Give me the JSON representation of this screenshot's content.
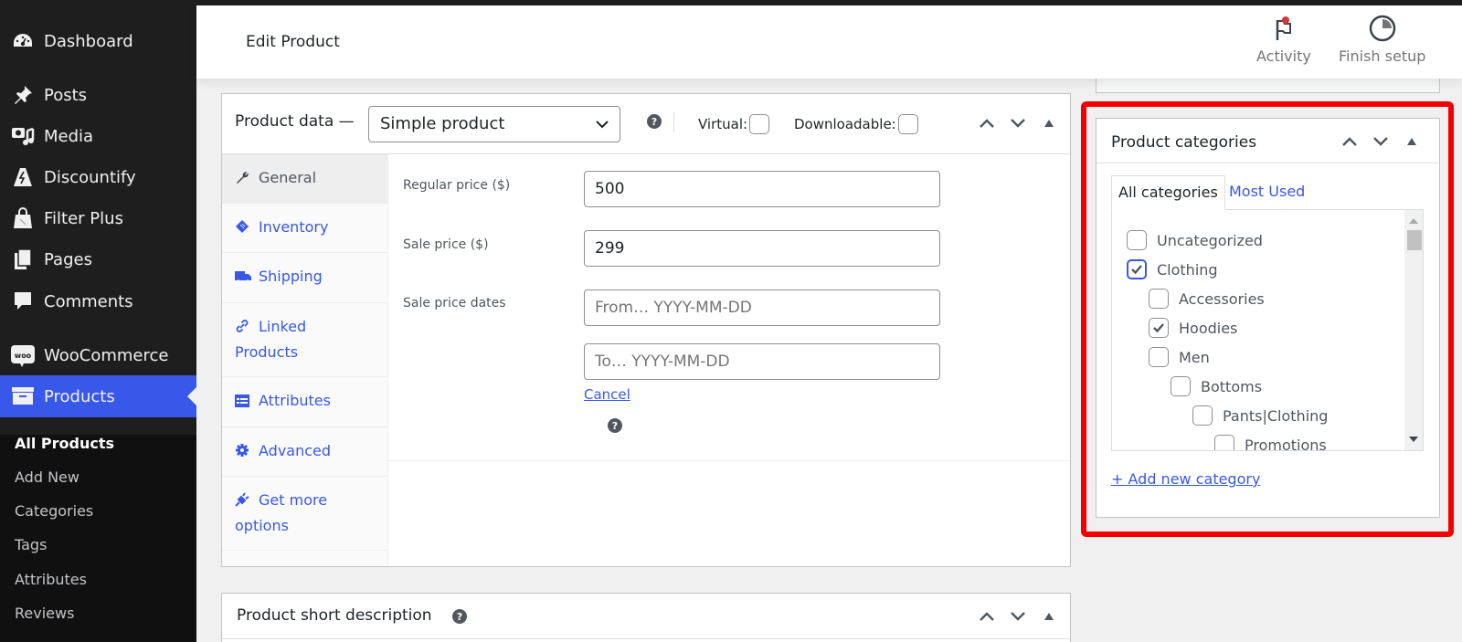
{
  "sidebar": {
    "items": [
      {
        "label": "Dashboard",
        "icon": "dashboard-icon"
      },
      {
        "label": "Posts",
        "icon": "pin-icon"
      },
      {
        "label": "Media",
        "icon": "media-icon"
      },
      {
        "label": "Discountify",
        "icon": "discountify-icon"
      },
      {
        "label": "Filter Plus",
        "icon": "filter-plus-icon"
      },
      {
        "label": "Pages",
        "icon": "pages-icon"
      },
      {
        "label": "Comments",
        "icon": "comment-icon"
      },
      {
        "label": "WooCommerce",
        "icon": "woocommerce-icon"
      },
      {
        "label": "Products",
        "icon": "archive-box-icon"
      }
    ],
    "woo_badge": "woo",
    "submenu": [
      "All Products",
      "Add New",
      "Categories",
      "Tags",
      "Attributes",
      "Reviews"
    ],
    "active_color": "#3858e9"
  },
  "header": {
    "title": "Edit Product",
    "activity_label": "Activity",
    "finish_setup_label": "Finish setup"
  },
  "product_data": {
    "title": "Product data —",
    "product_type": "Simple product",
    "virtual_label": "Virtual:",
    "downloadable_label": "Downloadable:",
    "virtual_checked": false,
    "downloadable_checked": false,
    "help_glyph": "?",
    "tabs": [
      {
        "label": "General",
        "icon": "wrench-icon"
      },
      {
        "label": "Inventory",
        "icon": "tag-icon"
      },
      {
        "label": "Shipping",
        "icon": "truck-icon"
      },
      {
        "label": "Linked Products",
        "icon": "link-icon"
      },
      {
        "label": "Attributes",
        "icon": "list-icon"
      },
      {
        "label": "Advanced",
        "icon": "gear-icon"
      },
      {
        "label": "Get more options",
        "icon": "plug-icon"
      }
    ],
    "fields": {
      "regular_price_label": "Regular price ($)",
      "regular_price_value": "500",
      "sale_price_label": "Sale price ($)",
      "sale_price_value": "299",
      "sale_dates_label": "Sale price dates",
      "from_placeholder": "From… YYYY-MM-DD",
      "to_placeholder": "To…  YYYY-MM-DD",
      "cancel_label": "Cancel"
    }
  },
  "short_description": {
    "title": "Product short description"
  },
  "categories": {
    "title": "Product categories",
    "tab_all": "All categories",
    "tab_most_used": "Most Used",
    "items": [
      {
        "label": "Uncategorized",
        "checked": false,
        "level": 0
      },
      {
        "label": "Clothing",
        "checked": true,
        "level": 0
      },
      {
        "label": "Accessories",
        "checked": false,
        "level": 1
      },
      {
        "label": "Hoodies",
        "checked": true,
        "level": 1
      },
      {
        "label": "Men",
        "checked": false,
        "level": 1
      },
      {
        "label": "Bottoms",
        "checked": false,
        "level": 2
      },
      {
        "label": "Pants|Clothing",
        "checked": false,
        "level": 3
      },
      {
        "label": "Promotions",
        "checked": false,
        "level": 4
      }
    ],
    "add_new_label": "+ Add new category",
    "highlight_color": "#f50000"
  }
}
